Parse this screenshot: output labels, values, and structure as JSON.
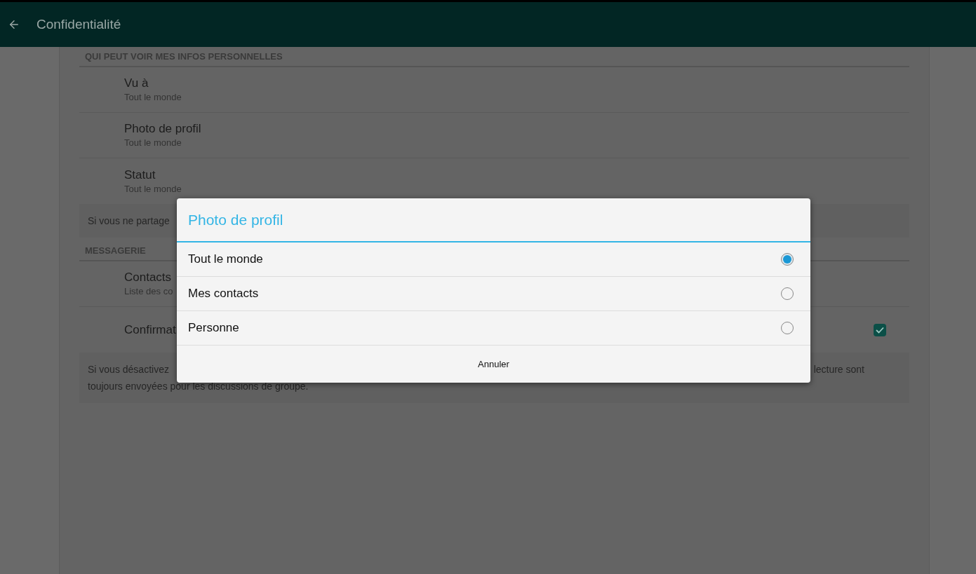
{
  "app_bar": {
    "title": "Confidentialité"
  },
  "sections": [
    {
      "header": "QUI PEUT VOIR MES INFOS PERSONNELLES",
      "items": [
        {
          "kind": "setting",
          "title": "Vu à",
          "subtitle": "Tout le monde"
        },
        {
          "kind": "setting",
          "title": "Photo de profil",
          "subtitle": "Tout le monde"
        },
        {
          "kind": "setting",
          "title": "Statut",
          "subtitle": "Tout le monde"
        },
        {
          "kind": "note",
          "lines": [
            [
              "Si vous ne partage"
            ]
          ]
        }
      ]
    },
    {
      "header": "MESSAGERIE",
      "items": [
        {
          "kind": "setting",
          "title": "Contacts",
          "subtitle": "Liste des co"
        },
        {
          "kind": "toggle",
          "title": "Confirmat",
          "checked": true
        },
        {
          "kind": "note",
          "lines": [
            [
              "Si vous désactivez",
              "lecture sont"
            ],
            [
              "toujours envoyées pour les discussions de groupe."
            ]
          ]
        }
      ]
    }
  ],
  "dialog": {
    "title": "Photo de profil",
    "options": [
      {
        "label": "Tout le monde",
        "selected": true
      },
      {
        "label": "Mes contacts",
        "selected": false
      },
      {
        "label": "Personne",
        "selected": false
      }
    ],
    "buttons": [
      "Annuler"
    ]
  }
}
